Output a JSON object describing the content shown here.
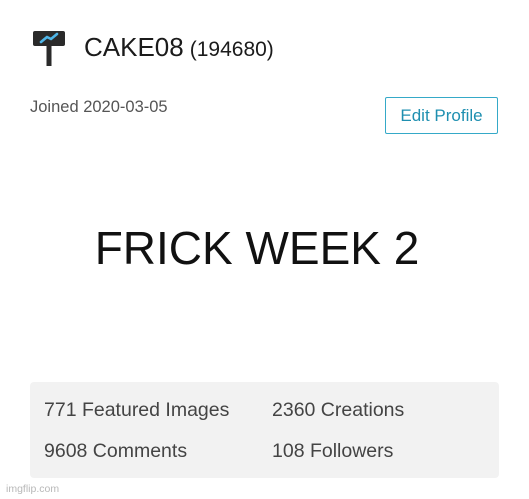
{
  "profile": {
    "username": "CAKE08",
    "points": "(194680)",
    "joined": "Joined 2020-03-05",
    "edit_label": "Edit Profile",
    "avatar_icon": "hammer-icon"
  },
  "content": {
    "caption": "FRICK WEEK 2"
  },
  "stats": {
    "featured": "771 Featured Images",
    "creations": "2360 Creations",
    "comments": "9608 Comments",
    "followers": "108 Followers"
  },
  "watermark": "imgflip.com",
  "colors": {
    "accent": "#35a9c8",
    "stats_bg": "#f2f2f2",
    "avatar_dark": "#2a2a2a",
    "avatar_light": "#4fb6e8"
  }
}
